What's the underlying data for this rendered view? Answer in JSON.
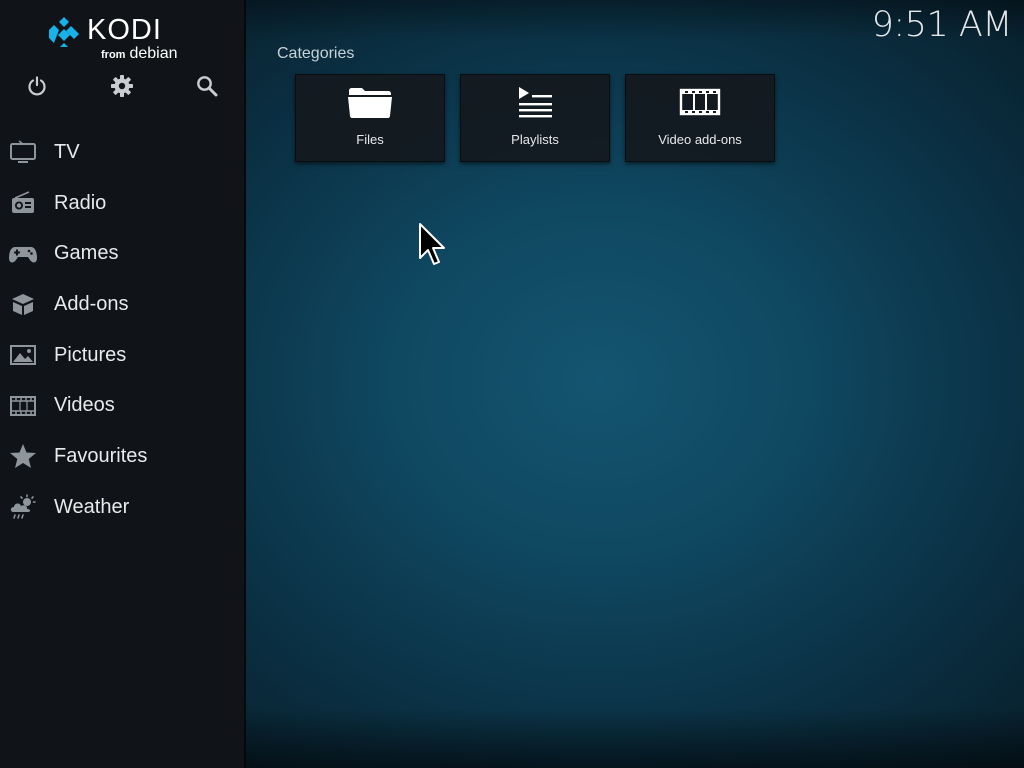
{
  "brand": {
    "name": "KODI",
    "from_label": "from",
    "distro_label": "debian",
    "logo_icon": "kodi-logo-icon"
  },
  "clock": {
    "time": "9:51 AM"
  },
  "top_controls": [
    {
      "name": "power",
      "icon": "power-icon"
    },
    {
      "name": "settings",
      "icon": "gear-icon"
    },
    {
      "name": "search",
      "icon": "search-icon"
    }
  ],
  "menu": {
    "items": [
      {
        "label": "TV",
        "icon": "tv-icon"
      },
      {
        "label": "Radio",
        "icon": "radio-icon"
      },
      {
        "label": "Games",
        "icon": "gamepad-icon"
      },
      {
        "label": "Add-ons",
        "icon": "addons-box-icon"
      },
      {
        "label": "Pictures",
        "icon": "picture-icon"
      },
      {
        "label": "Videos",
        "icon": "film-icon"
      },
      {
        "label": "Favourites",
        "icon": "star-icon"
      },
      {
        "label": "Weather",
        "icon": "weather-icon"
      }
    ]
  },
  "main": {
    "section_title": "Categories",
    "tiles": [
      {
        "label": "Files",
        "icon": "folder-icon"
      },
      {
        "label": "Playlists",
        "icon": "playlist-icon"
      },
      {
        "label": "Video add-ons",
        "icon": "film-strip-icon"
      }
    ]
  },
  "colors": {
    "sidebar_bg": "#101317",
    "main_bg_center": "#145570",
    "main_bg_edge": "#081f2c",
    "tile_bg": "#141a1f",
    "kodi_blue": "#17b2e7",
    "text": "#e8eaec"
  }
}
